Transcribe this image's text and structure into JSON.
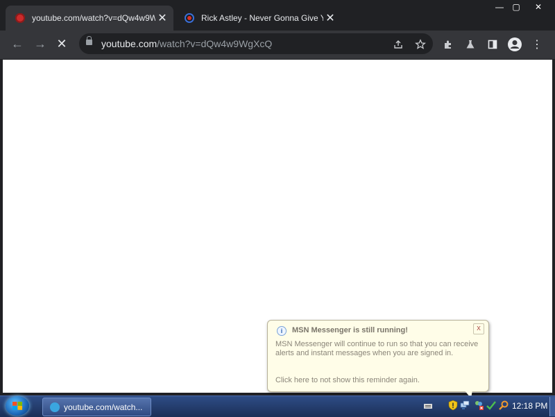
{
  "browser": {
    "tabs": [
      {
        "title": "youtube.com/watch?v=dQw4w9W",
        "active": true,
        "close": "✕"
      },
      {
        "title": "Rick Astley - Never Gonna Give Yo",
        "active": false,
        "close": "✕"
      }
    ],
    "window_controls": {
      "minimize": "—",
      "maximize": "▢",
      "close": "✕"
    },
    "nav": {
      "back": "←",
      "forward": "→",
      "stop": "✕"
    },
    "address": {
      "host": "youtube.com",
      "path": "/watch?v=dQw4w9WgXcQ"
    },
    "toolbar_icons": [
      "share-icon",
      "star-icon",
      "extensions-icon",
      "flask-icon",
      "sidepanel-icon",
      "profile-icon",
      "menu-icon"
    ]
  },
  "balloon": {
    "title": "MSN Messenger is still running!",
    "body": "MSN Messenger will continue to run so that you can receive alerts and instant messages when you are signed in.",
    "link": "Click here to not show this reminder again.",
    "close": "x"
  },
  "taskbar": {
    "task_label": "youtube.com/watch...",
    "clock": "12:18 PM"
  },
  "colors": {
    "tab_active": "#35363a",
    "frame": "#202124",
    "taskbar": "#1b2f57",
    "balloon_bg": "#fffde8"
  }
}
